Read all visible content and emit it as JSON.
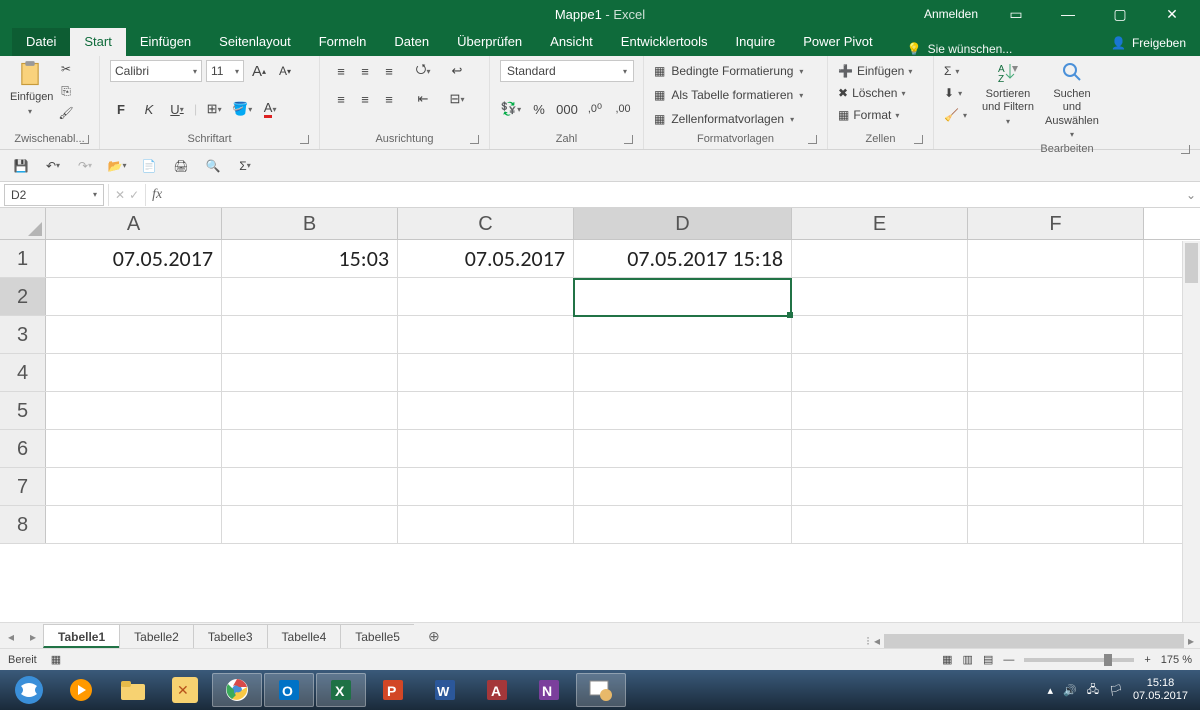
{
  "title": {
    "doc": "Mappe1",
    "app": " - Excel"
  },
  "titlebar": {
    "signin": "Anmelden"
  },
  "tabs": {
    "file": "Datei",
    "start": "Start",
    "insert": "Einfügen",
    "layout": "Seitenlayout",
    "formulas": "Formeln",
    "data": "Daten",
    "review": "Überprüfen",
    "view": "Ansicht",
    "dev": "Entwicklertools",
    "inquire": "Inquire",
    "powerpivot": "Power Pivot",
    "tell": "Sie wünschen...",
    "share": "Freigeben"
  },
  "ribbon": {
    "clipboard": {
      "paste": "Einfügen",
      "group": "Zwischenabl..."
    },
    "font": {
      "name": "Calibri",
      "size": "11",
      "group": "Schriftart",
      "bold": "F",
      "italic": "K",
      "underline": "U",
      "incA": "A",
      "decA": "A"
    },
    "align": {
      "group": "Ausrichtung"
    },
    "number": {
      "format": "Standard",
      "group": "Zahl"
    },
    "styles": {
      "cond": "Bedingte Formatierung",
      "table": "Als Tabelle formatieren",
      "cell": "Zellenformatvorlagen",
      "group": "Formatvorlagen"
    },
    "cells": {
      "insert": "Einfügen",
      "delete": "Löschen",
      "format": "Format",
      "group": "Zellen"
    },
    "editing": {
      "sort": "Sortieren und Filtern",
      "find": "Suchen und Auswählen",
      "group": "Bearbeiten"
    }
  },
  "namebox": "D2",
  "columns": [
    "A",
    "B",
    "C",
    "D",
    "E",
    "F"
  ],
  "rows": [
    "1",
    "2",
    "3",
    "4",
    "5",
    "6",
    "7",
    "8"
  ],
  "cells": {
    "A1": "07.05.2017",
    "B1": "15:03",
    "C1": "07.05.2017",
    "D1": "07.05.2017 15:18"
  },
  "selected": "D2",
  "sheets": [
    "Tabelle1",
    "Tabelle2",
    "Tabelle3",
    "Tabelle4",
    "Tabelle5"
  ],
  "status": {
    "ready": "Bereit",
    "zoom": "175 %"
  },
  "tray": {
    "time": "15:18",
    "date": "07.05.2017"
  }
}
